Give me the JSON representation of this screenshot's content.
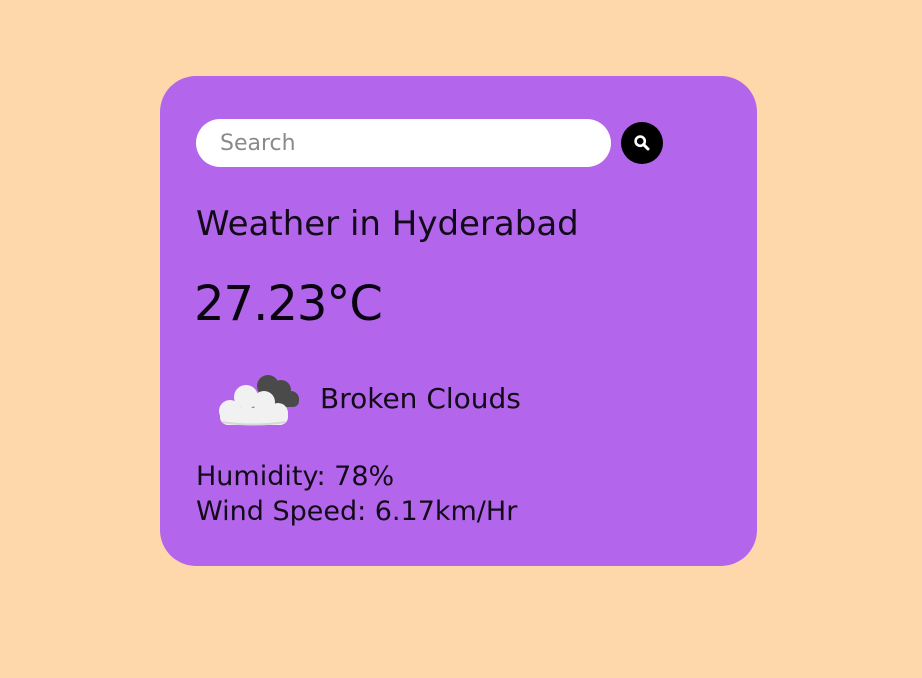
{
  "search": {
    "placeholder": "Search",
    "value": ""
  },
  "weather": {
    "title": "Weather in Hyderabad",
    "temperature": "27.23°C",
    "condition_icon": "broken-clouds-icon",
    "condition": "Broken Clouds",
    "humidity": "Humidity: 78%",
    "wind_speed": "Wind Speed: 6.17km/Hr"
  },
  "colors": {
    "background": "#fed7ab",
    "card": "#b366ec",
    "search_button": "#000000"
  }
}
